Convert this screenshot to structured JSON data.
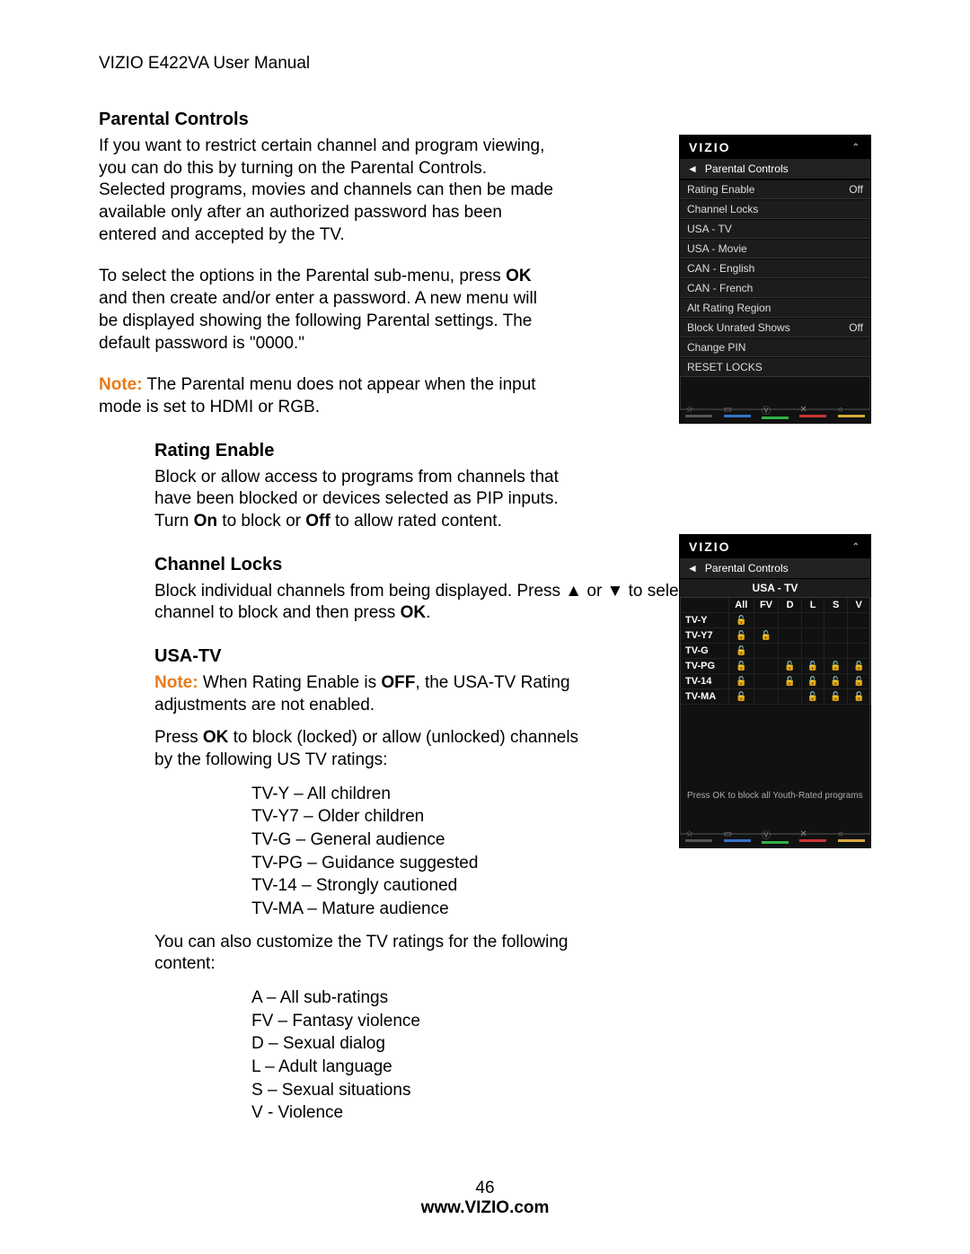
{
  "doc": {
    "header": "VIZIO E422VA User Manual",
    "page_number": "46",
    "footer_url": "www.VIZIO.com"
  },
  "sections": {
    "parental_controls": {
      "title": "Parental Controls",
      "p1a": " If you want to restrict certain channel and program viewing, you can do this by turning on the Parental Controls. Selected programs, movies and channels can then be made available only after an authorized password has been entered and accepted by the TV.",
      "p2a": "To select the options in the Parental sub-menu, press ",
      "p2b": "OK",
      "p2c": " and then create and/or enter a password. A new menu will be displayed showing the following Parental settings. The default password is \"0000.\"",
      "note_label": "Note:",
      "note_text": " The Parental menu does not appear when the input mode is set to HDMI or RGB."
    },
    "rating_enable": {
      "title": "Rating Enable",
      "p_a": "Block or allow access to programs from channels that have been blocked or devices selected as PIP inputs. Turn ",
      "p_b": "On",
      "p_c": " to block or ",
      "p_d": "Off",
      "p_e": " to allow rated content."
    },
    "channel_locks": {
      "title": "Channel Locks",
      "p_a": "Block individual channels from being displayed. Press ▲ or ▼ to select a channel to block and then press ",
      "p_b": "OK",
      "p_c": "."
    },
    "usa_tv": {
      "title": "USA-TV",
      "note_label": "Note:",
      "note_a": " When Rating Enable is ",
      "note_b": "OFF",
      "note_c": ", the USA-TV Rating adjustments are not enabled.",
      "p2a": "Press ",
      "p2b": "OK",
      "p2c": " to block (locked) or allow (unlocked) channels by the following US TV ratings:",
      "ratings": [
        "TV-Y – All children",
        "TV-Y7 – Older children",
        "TV-G – General audience",
        "TV-PG – Guidance suggested",
        "TV-14 – Strongly cautioned",
        "TV-MA – Mature audience"
      ],
      "p3": "You can also customize the TV ratings for the following content:",
      "subratings": [
        "A – All sub-ratings",
        "FV – Fantasy violence",
        "D – Sexual dialog",
        "L – Adult language",
        "S – Sexual situations",
        "V - Violence"
      ]
    }
  },
  "osd1": {
    "brand": "VIZIO",
    "breadcrumb": "Parental Controls",
    "rows": [
      {
        "label": "Rating Enable",
        "value": "Off"
      },
      {
        "label": "Channel Locks",
        "value": ""
      },
      {
        "label": "USA - TV",
        "value": ""
      },
      {
        "label": "USA - Movie",
        "value": ""
      },
      {
        "label": "CAN - English",
        "value": ""
      },
      {
        "label": "CAN - French",
        "value": ""
      },
      {
        "label": "Alt Rating Region",
        "value": ""
      },
      {
        "label": "Block Unrated Shows",
        "value": "Off"
      },
      {
        "label": "Change PIN",
        "value": ""
      },
      {
        "label": "RESET LOCKS",
        "value": ""
      }
    ]
  },
  "osd2": {
    "brand": "VIZIO",
    "breadcrumb": "Parental Controls",
    "subtitle": "USA - TV",
    "columns": [
      "",
      "All",
      "FV",
      "D",
      "L",
      "S",
      "V"
    ],
    "rows": [
      {
        "label": "TV-Y",
        "cells": [
          "🔓",
          "",
          "",
          "",
          "",
          ""
        ]
      },
      {
        "label": "TV-Y7",
        "cells": [
          "🔓",
          "🔓",
          "",
          "",
          "",
          ""
        ]
      },
      {
        "label": "TV-G",
        "cells": [
          "🔓",
          "",
          "",
          "",
          "",
          ""
        ]
      },
      {
        "label": "TV-PG",
        "cells": [
          "🔓",
          "",
          "🔓",
          "🔓",
          "🔓",
          "🔓"
        ]
      },
      {
        "label": "TV-14",
        "cells": [
          "🔓",
          "",
          "🔓",
          "🔓",
          "🔓",
          "🔓"
        ]
      },
      {
        "label": "TV-MA",
        "cells": [
          "🔓",
          "",
          "",
          "🔓",
          "🔓",
          "🔓"
        ]
      }
    ],
    "hint": "Press OK to block all Youth-Rated programs"
  }
}
